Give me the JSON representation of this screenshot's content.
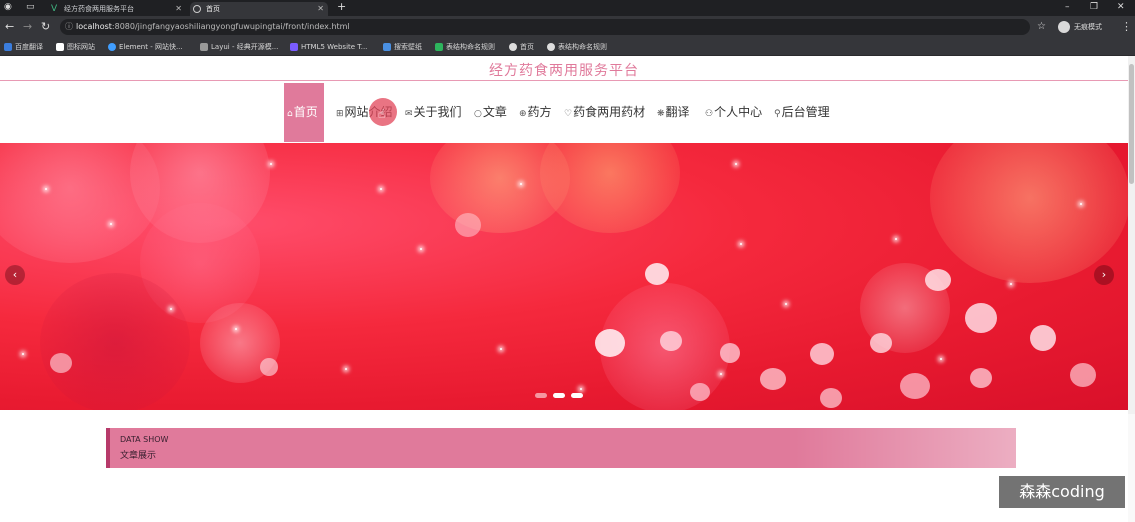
{
  "browser": {
    "tabs": [
      {
        "title": "经方药食两用服务平台",
        "active": false
      },
      {
        "title": "首页",
        "active": true
      }
    ],
    "new_tab": "+",
    "url_host": "localhost",
    "url_rest": ":8080/jingfangyaoshiliangyongfuwupingtai/front/index.html",
    "profile_label": "无痕模式",
    "bookmarks": [
      {
        "label": "百度翻译",
        "color": "#3b7ddd"
      },
      {
        "label": "图标网站",
        "color": "#ffffff"
      },
      {
        "label": "Element - 网站快...",
        "color": "#409eff"
      },
      {
        "label": "Layui - 经典开源模...",
        "color": "#999999"
      },
      {
        "label": "HTML5 Website T...",
        "color": "#7a5cff"
      },
      {
        "label": "搜索壁纸",
        "color": "#4a90e2"
      },
      {
        "label": "表结构命名规则",
        "color": "#2db55d"
      },
      {
        "label": "首页",
        "color": "#dddddd"
      },
      {
        "label": "表结构命名规则",
        "color": "#dddddd"
      }
    ]
  },
  "site": {
    "title": "经方药食两用服务平台",
    "accent": "#e07a9b",
    "menu": [
      {
        "icon": "⌂",
        "label": "首页",
        "active": true
      },
      {
        "icon": "⊞",
        "label": "网站介绍",
        "active": false
      },
      {
        "icon": "✉",
        "label": "关于我们",
        "active": false
      },
      {
        "icon": "○",
        "label": "文章",
        "active": false
      },
      {
        "icon": "⊕",
        "label": "药方",
        "active": false
      },
      {
        "icon": "♡",
        "label": "药食两用药材",
        "active": false
      },
      {
        "icon": "❋",
        "label": "翻译",
        "active": false
      },
      {
        "icon": "⚇",
        "label": "个人中心",
        "active": false
      },
      {
        "icon": "⚲",
        "label": "后台管理",
        "active": false
      }
    ],
    "carousel": {
      "prev": "‹",
      "next": "›",
      "slide_count": 3,
      "active_index": 1
    },
    "data_show": {
      "en": "DATA SHOW",
      "cn": "文章展示"
    }
  },
  "watermark": "森森coding"
}
